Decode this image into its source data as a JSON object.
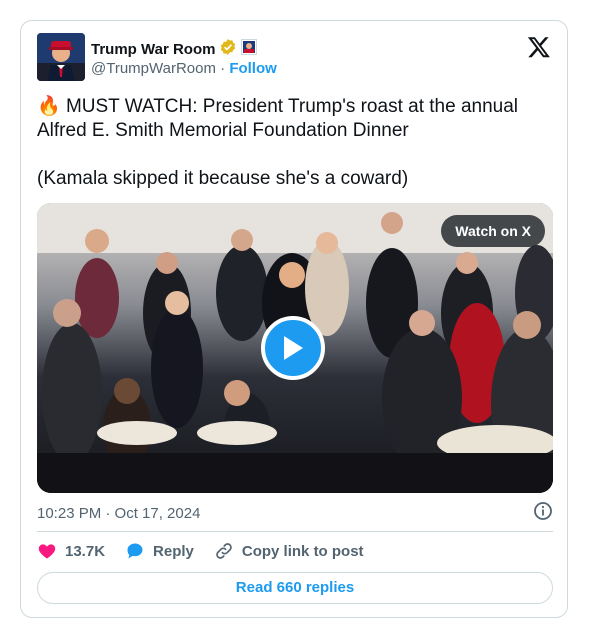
{
  "author": {
    "name": "Trump War Room",
    "handle": "@TrumpWarRoom",
    "separator": "·",
    "follow_label": "Follow"
  },
  "tweet": {
    "emoji": "🔥",
    "text_line1": " MUST WATCH: President Trump's roast at the annual\nAlfred E. Smith Memorial Foundation Dinner\n\n(Kamala skipped it because she's a coward)"
  },
  "video": {
    "watch_label": "Watch on X"
  },
  "meta": {
    "time": "10:23 PM · Oct 17, 2024"
  },
  "actions": {
    "likes": "13.7K",
    "reply_label": "Reply",
    "copy_label": "Copy link to post"
  },
  "read_replies_label": "Read 660 replies",
  "colors": {
    "accent": "#1d9bf0",
    "like": "#f91880",
    "verified": "#e2b719"
  }
}
